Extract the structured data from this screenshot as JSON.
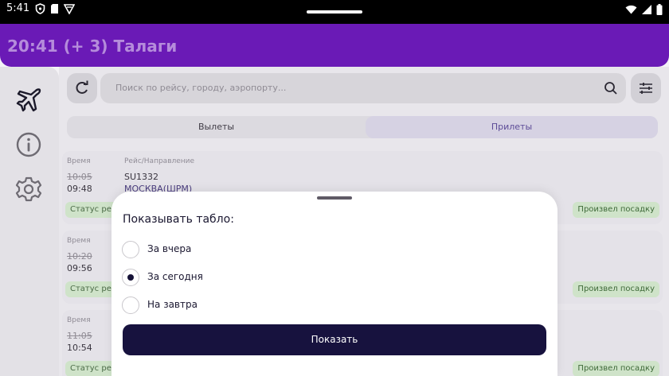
{
  "status_bar": {
    "time": "5:41",
    "left_icons": [
      "shield-icon",
      "sd-card-icon",
      "vpn-icon"
    ],
    "right_icons": [
      "wifi-icon",
      "signal-icon",
      "battery-icon"
    ]
  },
  "app_bar": {
    "title": "20:41 (+ 3) Талаги",
    "color": "#6a1ab6"
  },
  "rail": {
    "items": [
      "plane-icon",
      "info-icon",
      "settings-icon"
    ]
  },
  "search": {
    "placeholder": "Поиск по рейсу, городу, аэропорту..."
  },
  "tabs": [
    {
      "label": "Вылеты",
      "selected": false
    },
    {
      "label": "Прилеты",
      "selected": true
    }
  ],
  "flights": [
    {
      "time_label": "Время",
      "flight_label": "Рейс/Направление",
      "scheduled": "10:05",
      "actual": "09:48",
      "flight_no": "SU1332",
      "destination": "МОСКВА(ШРМ)",
      "status_label": "Статус рейса",
      "status": "Произвел посадку"
    },
    {
      "time_label": "Время",
      "scheduled": "10:20",
      "actual": "09:56",
      "status_label": "Статус рейса",
      "status": "Произвел посадку"
    },
    {
      "time_label": "Время",
      "scheduled": "11:05",
      "actual": "10:54",
      "status_label": "Статус рейса",
      "status": "Произвел посадку"
    }
  ],
  "sheet": {
    "title": "Показывать табло:",
    "options": [
      {
        "label": "За вчера",
        "selected": false
      },
      {
        "label": "За сегодня",
        "selected": true
      },
      {
        "label": "На завтра",
        "selected": false
      }
    ],
    "button": "Показать",
    "button_color": "#17123e"
  }
}
